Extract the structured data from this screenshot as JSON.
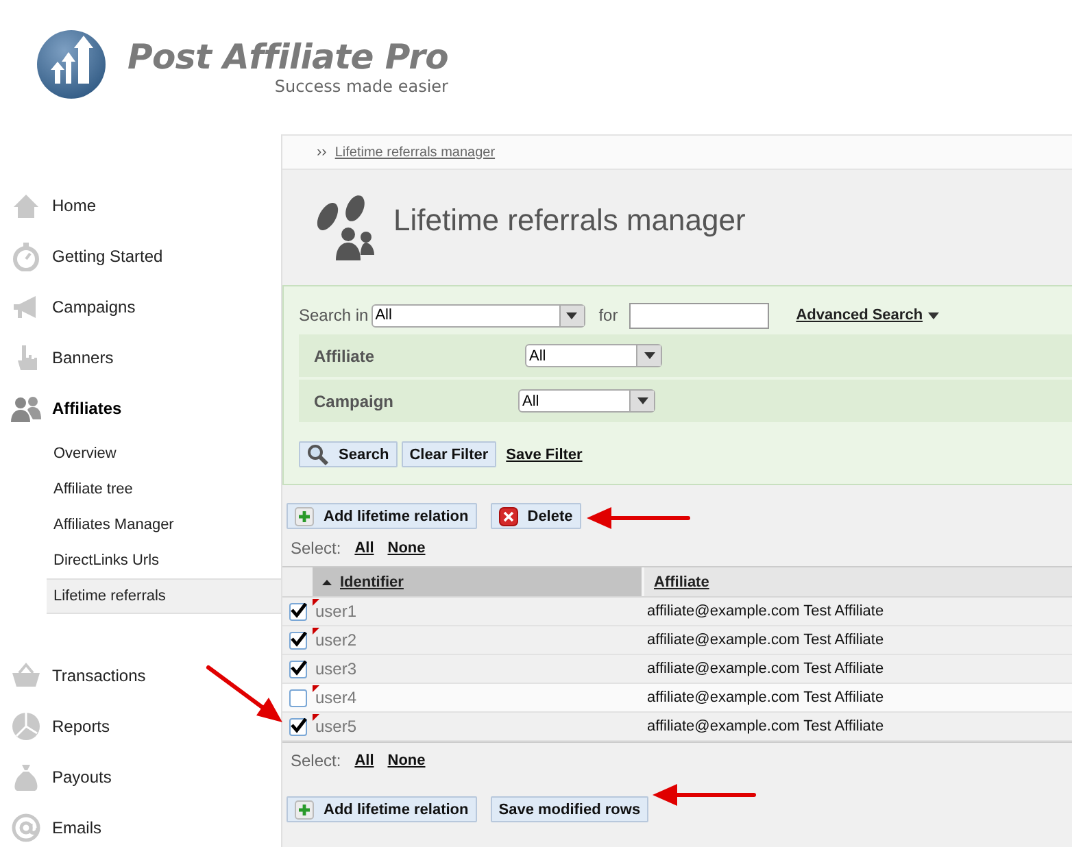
{
  "logo": {
    "title": "Post Affiliate Pro",
    "tagline": "Success made easier"
  },
  "sidebar": {
    "items": [
      {
        "label": "Home",
        "selected": false
      },
      {
        "label": "Getting Started",
        "selected": false
      },
      {
        "label": "Campaigns",
        "selected": false
      },
      {
        "label": "Banners",
        "selected": false
      },
      {
        "label": "Affiliates",
        "selected": true,
        "expanded": true,
        "children": [
          {
            "label": "Overview",
            "selected": false
          },
          {
            "label": "Affiliate tree",
            "selected": false
          },
          {
            "label": "Affiliates Manager",
            "selected": false
          },
          {
            "label": "DirectLinks Urls",
            "selected": false
          },
          {
            "label": "Lifetime referrals",
            "selected": true
          }
        ]
      },
      {
        "label": "Transactions",
        "selected": false
      },
      {
        "label": "Reports",
        "selected": false
      },
      {
        "label": "Payouts",
        "selected": false
      },
      {
        "label": "Emails",
        "selected": false
      }
    ]
  },
  "breadcrumb": {
    "separator": "››",
    "label": "Lifetime referrals manager"
  },
  "title": "Lifetime referrals manager",
  "filter": {
    "search_in": {
      "label": "Search in",
      "value": "All"
    },
    "for_label": "for",
    "advanced_search": "Advanced Search",
    "fields": [
      {
        "label": "Affiliate",
        "value": "All"
      },
      {
        "label": "Campaign",
        "value": "All"
      }
    ],
    "buttons": [
      {
        "label": "Search",
        "kind": "search"
      },
      {
        "label": "Clear Filter",
        "kind": "plain"
      },
      {
        "label": "Save Filter",
        "kind": "link"
      }
    ]
  },
  "top_actions": [
    {
      "label": "Add lifetime relation",
      "kind": "add"
    },
    {
      "label": "Delete",
      "kind": "delete"
    }
  ],
  "select_top": {
    "label": "Select:",
    "links": [
      "All",
      "None"
    ]
  },
  "table": {
    "columns": [
      {
        "label": "Identifier",
        "sorted": true
      },
      {
        "label": "Affiliate",
        "sorted": false
      }
    ],
    "rows": [
      {
        "checked": true,
        "modified": true,
        "identifier": "user1",
        "affiliate": "affiliate@example.com Test Affiliate"
      },
      {
        "checked": true,
        "modified": true,
        "identifier": "user2",
        "affiliate": "affiliate@example.com Test Affiliate"
      },
      {
        "checked": true,
        "modified": false,
        "identifier": "user3",
        "affiliate": "affiliate@example.com Test Affiliate"
      },
      {
        "checked": false,
        "modified": true,
        "identifier": "user4",
        "affiliate": "affiliate@example.com Test Affiliate"
      },
      {
        "checked": true,
        "modified": true,
        "identifier": "user5",
        "affiliate": "affiliate@example.com Test Affiliate"
      }
    ]
  },
  "select_bottom": {
    "label": "Select:",
    "links": [
      "All",
      "None"
    ]
  },
  "bottom_actions": [
    {
      "label": "Add lifetime relation",
      "kind": "add"
    },
    {
      "label": "Save modified rows",
      "kind": "plain"
    }
  ]
}
